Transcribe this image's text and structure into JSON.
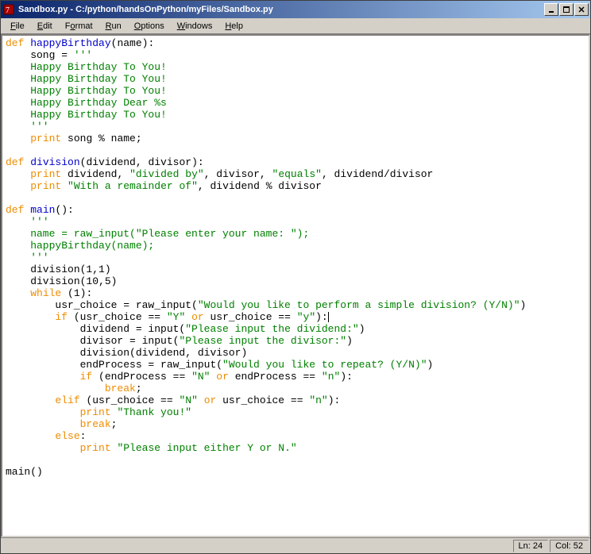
{
  "titlebar": {
    "title": "Sandbox.py - C:/python/handsOnPython/myFiles/Sandbox.py"
  },
  "menubar": {
    "items": [
      {
        "label": "File",
        "hotkey": "F"
      },
      {
        "label": "Edit",
        "hotkey": "E"
      },
      {
        "label": "Format",
        "hotkey": "o"
      },
      {
        "label": "Run",
        "hotkey": "R"
      },
      {
        "label": "Options",
        "hotkey": "O"
      },
      {
        "label": "Windows",
        "hotkey": "W"
      },
      {
        "label": "Help",
        "hotkey": "H"
      }
    ]
  },
  "code": {
    "lines": [
      [
        [
          "k-kw",
          "def "
        ],
        [
          "k-fn",
          "happyBirthday"
        ],
        [
          "k-id",
          "(name):"
        ]
      ],
      [
        [
          "k-id",
          "    song = "
        ],
        [
          "k-str",
          "'''"
        ]
      ],
      [
        [
          "k-str",
          "    Happy Birthday To You!"
        ]
      ],
      [
        [
          "k-str",
          "    Happy Birthday To You!"
        ]
      ],
      [
        [
          "k-str",
          "    Happy Birthday To You!"
        ]
      ],
      [
        [
          "k-str",
          "    Happy Birthday Dear %s"
        ]
      ],
      [
        [
          "k-str",
          "    Happy Birthday To You!"
        ]
      ],
      [
        [
          "k-str",
          "    '''"
        ]
      ],
      [
        [
          "k-id",
          "    "
        ],
        [
          "k-kw",
          "print"
        ],
        [
          "k-id",
          " song % name;"
        ]
      ],
      [
        [
          "k-id",
          ""
        ]
      ],
      [
        [
          "k-kw",
          "def "
        ],
        [
          "k-fn",
          "division"
        ],
        [
          "k-id",
          "(dividend, divisor):"
        ]
      ],
      [
        [
          "k-id",
          "    "
        ],
        [
          "k-kw",
          "print"
        ],
        [
          "k-id",
          " dividend, "
        ],
        [
          "k-str",
          "\"divided by\""
        ],
        [
          "k-id",
          ", divisor, "
        ],
        [
          "k-str",
          "\"equals\""
        ],
        [
          "k-id",
          ", dividend/divisor"
        ]
      ],
      [
        [
          "k-id",
          "    "
        ],
        [
          "k-kw",
          "print"
        ],
        [
          "k-id",
          " "
        ],
        [
          "k-str",
          "\"With a remainder of\""
        ],
        [
          "k-id",
          ", dividend % divisor"
        ]
      ],
      [
        [
          "k-id",
          ""
        ]
      ],
      [
        [
          "k-kw",
          "def "
        ],
        [
          "k-fn",
          "main"
        ],
        [
          "k-id",
          "():"
        ]
      ],
      [
        [
          "k-id",
          "    "
        ],
        [
          "k-str",
          "'''"
        ]
      ],
      [
        [
          "k-str",
          "    name = raw_input(\"Please enter your name: \");"
        ]
      ],
      [
        [
          "k-str",
          "    happyBirthday(name);"
        ]
      ],
      [
        [
          "k-str",
          "    '''"
        ]
      ],
      [
        [
          "k-id",
          "    division(1,1)"
        ]
      ],
      [
        [
          "k-id",
          "    division(10,5)"
        ]
      ],
      [
        [
          "k-id",
          "    "
        ],
        [
          "k-kw",
          "while"
        ],
        [
          "k-id",
          " (1):"
        ]
      ],
      [
        [
          "k-id",
          "        usr_choice = raw_input("
        ],
        [
          "k-str",
          "\"Would you like to perform a simple division? (Y/N)\""
        ],
        [
          "k-id",
          ")"
        ]
      ],
      [
        [
          "k-id",
          "        "
        ],
        [
          "k-kw",
          "if"
        ],
        [
          "k-id",
          " (usr_choice == "
        ],
        [
          "k-str",
          "\"Y\""
        ],
        [
          "k-id",
          " "
        ],
        [
          "k-kw",
          "or"
        ],
        [
          "k-id",
          " usr_choice == "
        ],
        [
          "k-str",
          "\"y\""
        ],
        [
          "k-id",
          "):"
        ],
        [
          "cursor",
          ""
        ]
      ],
      [
        [
          "k-id",
          "            dividend = input("
        ],
        [
          "k-str",
          "\"Please input the dividend:\""
        ],
        [
          "k-id",
          ")"
        ]
      ],
      [
        [
          "k-id",
          "            divisor = input("
        ],
        [
          "k-str",
          "\"Please input the divisor:\""
        ],
        [
          "k-id",
          ")"
        ]
      ],
      [
        [
          "k-id",
          "            division(dividend, divisor)"
        ]
      ],
      [
        [
          "k-id",
          "            endProcess = raw_input("
        ],
        [
          "k-str",
          "\"Would you like to repeat? (Y/N)\""
        ],
        [
          "k-id",
          ")"
        ]
      ],
      [
        [
          "k-id",
          "            "
        ],
        [
          "k-kw",
          "if"
        ],
        [
          "k-id",
          " (endProcess == "
        ],
        [
          "k-str",
          "\"N\""
        ],
        [
          "k-id",
          " "
        ],
        [
          "k-kw",
          "or"
        ],
        [
          "k-id",
          " endProcess == "
        ],
        [
          "k-str",
          "\"n\""
        ],
        [
          "k-id",
          "):"
        ]
      ],
      [
        [
          "k-id",
          "                "
        ],
        [
          "k-kw",
          "break"
        ],
        [
          "k-id",
          ";"
        ]
      ],
      [
        [
          "k-id",
          "        "
        ],
        [
          "k-kw",
          "elif"
        ],
        [
          "k-id",
          " (usr_choice == "
        ],
        [
          "k-str",
          "\"N\""
        ],
        [
          "k-id",
          " "
        ],
        [
          "k-kw",
          "or"
        ],
        [
          "k-id",
          " usr_choice == "
        ],
        [
          "k-str",
          "\"n\""
        ],
        [
          "k-id",
          "):"
        ]
      ],
      [
        [
          "k-id",
          "            "
        ],
        [
          "k-kw",
          "print"
        ],
        [
          "k-id",
          " "
        ],
        [
          "k-str",
          "\"Thank you!\""
        ]
      ],
      [
        [
          "k-id",
          "            "
        ],
        [
          "k-kw",
          "break"
        ],
        [
          "k-id",
          ";"
        ]
      ],
      [
        [
          "k-id",
          "        "
        ],
        [
          "k-kw",
          "else"
        ],
        [
          "k-id",
          ":"
        ]
      ],
      [
        [
          "k-id",
          "            "
        ],
        [
          "k-kw",
          "print"
        ],
        [
          "k-id",
          " "
        ],
        [
          "k-str",
          "\"Please input either Y or N.\""
        ]
      ],
      [
        [
          "k-id",
          ""
        ]
      ],
      [
        [
          "k-id",
          "main()"
        ]
      ]
    ]
  },
  "status": {
    "ln_label": "Ln: 24",
    "col_label": "Col: 52"
  }
}
